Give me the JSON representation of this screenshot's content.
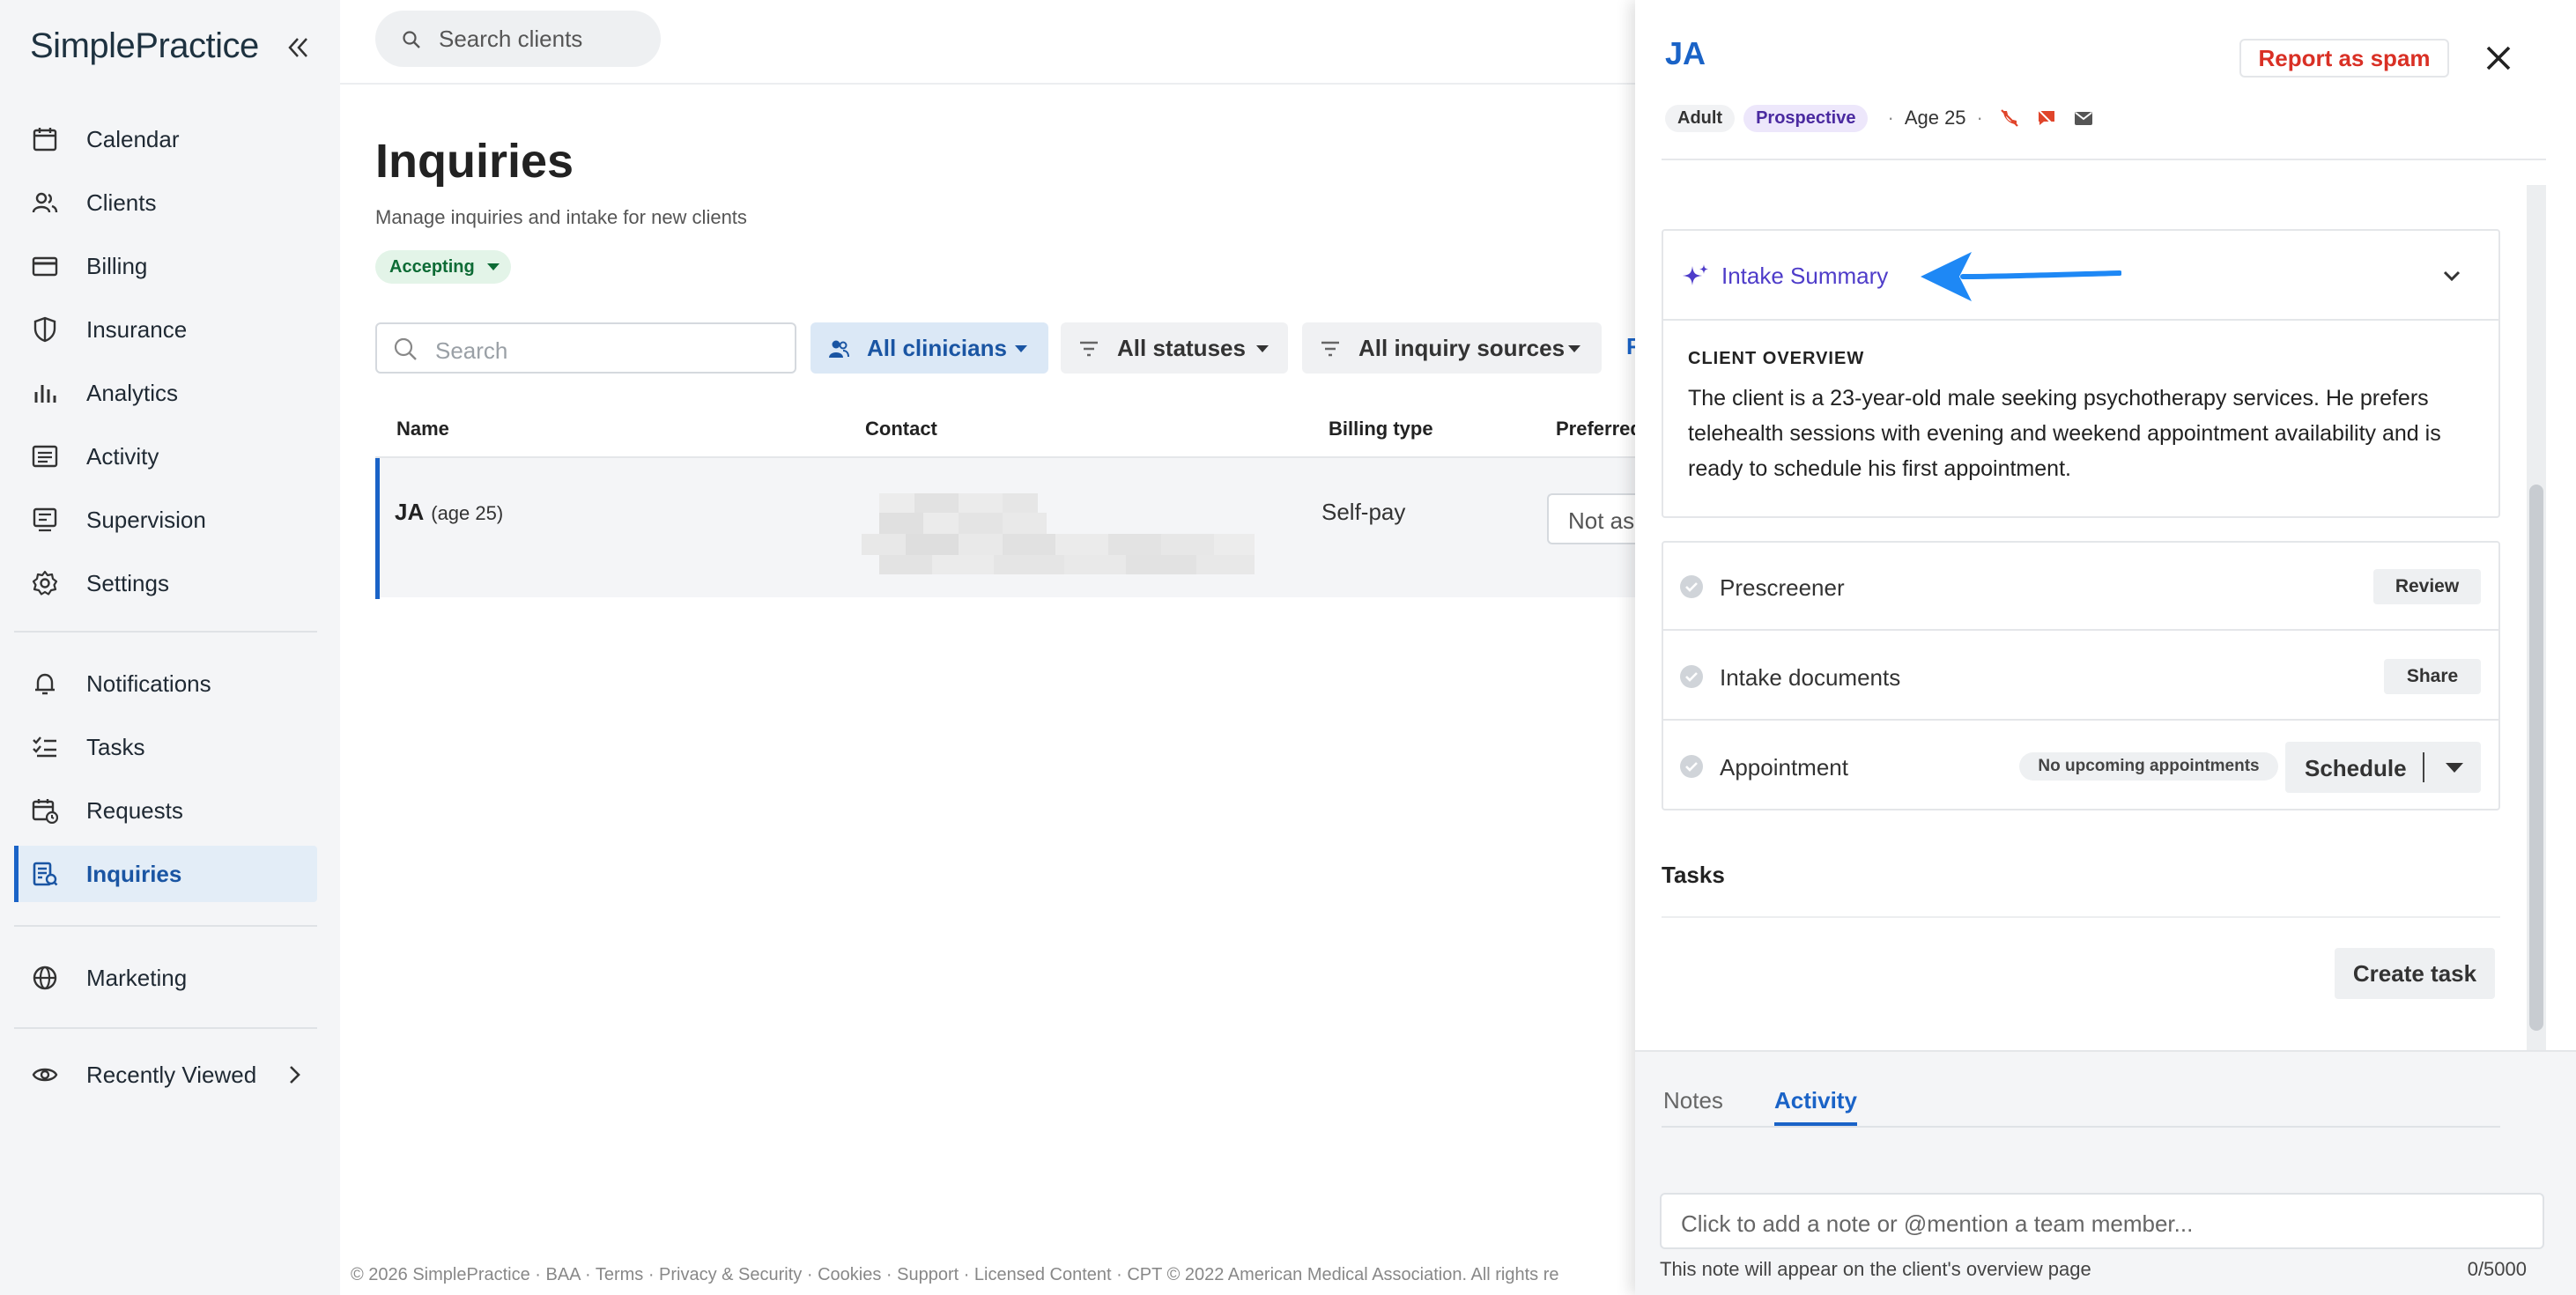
{
  "app": {
    "logo": "SimplePractice"
  },
  "sidebar": {
    "items": [
      {
        "label": "Calendar",
        "icon": "calendar-icon"
      },
      {
        "label": "Clients",
        "icon": "clients-icon"
      },
      {
        "label": "Billing",
        "icon": "billing-card-icon"
      },
      {
        "label": "Insurance",
        "icon": "shield-icon"
      },
      {
        "label": "Analytics",
        "icon": "bar-chart-icon"
      },
      {
        "label": "Activity",
        "icon": "activity-list-icon"
      },
      {
        "label": "Supervision",
        "icon": "supervision-icon"
      },
      {
        "label": "Settings",
        "icon": "gear-icon"
      }
    ],
    "items2": [
      {
        "label": "Notifications",
        "icon": "bell-icon"
      },
      {
        "label": "Tasks",
        "icon": "tasks-icon"
      },
      {
        "label": "Requests",
        "icon": "requests-calendar-icon"
      },
      {
        "label": "Inquiries",
        "icon": "inquiries-icon",
        "active": true
      }
    ],
    "marketing": {
      "label": "Marketing",
      "icon": "globe-icon"
    },
    "recently_viewed": {
      "label": "Recently Viewed",
      "icon": "eye-icon"
    }
  },
  "topbar": {
    "search_placeholder": "Search clients"
  },
  "page": {
    "title": "Inquiries",
    "subtitle": "Manage inquiries and intake for new clients",
    "status_badge": "Accepting"
  },
  "filters": {
    "search_placeholder": "Search",
    "clinicians": "All clinicians",
    "statuses": "All statuses",
    "sources": "All inquiry sources",
    "more": "F"
  },
  "table": {
    "columns": [
      "Name",
      "Contact",
      "Billing type",
      "Preferred"
    ],
    "rows": [
      {
        "name": "JA",
        "age": "(age 25)",
        "billing": "Self-pay",
        "preferred": "Not as"
      }
    ]
  },
  "footer": {
    "text": "© 2026 SimplePractice · BAA · Terms · Privacy & Security · Cookies · Support · Licensed Content · CPT © 2022 American Medical Association. All rights re"
  },
  "drawer": {
    "client_name": "JA",
    "report_spam": "Report as spam",
    "tag_adult": "Adult",
    "tag_status": "Prospective",
    "age": "Age 25",
    "intake_summary_label": "Intake Summary",
    "client_overview_title": "CLIENT OVERVIEW",
    "client_overview_text": "The client is a 23-year-old male seeking psychotherapy services. He prefers telehealth sessions with evening and weekend appointment availability and is ready to schedule his first appointment.",
    "steps": [
      {
        "label": "Prescreener",
        "action": "Review"
      },
      {
        "label": "Intake documents",
        "action": "Share"
      },
      {
        "label": "Appointment",
        "status": "No upcoming appointments",
        "action": "Schedule"
      }
    ],
    "tasks_title": "Tasks",
    "create_task": "Create task",
    "tabs": [
      "Notes",
      "Activity"
    ],
    "note_placeholder": "Click to add a note or @mention a team member...",
    "note_help": "This note will appear on the client's overview page",
    "note_count": "0/5000"
  },
  "colors": {
    "accent_blue": "#1a63c7",
    "spam_red": "#d93025",
    "intake_purple": "#4e3cc9",
    "accepting_green": "#0d6b35"
  }
}
